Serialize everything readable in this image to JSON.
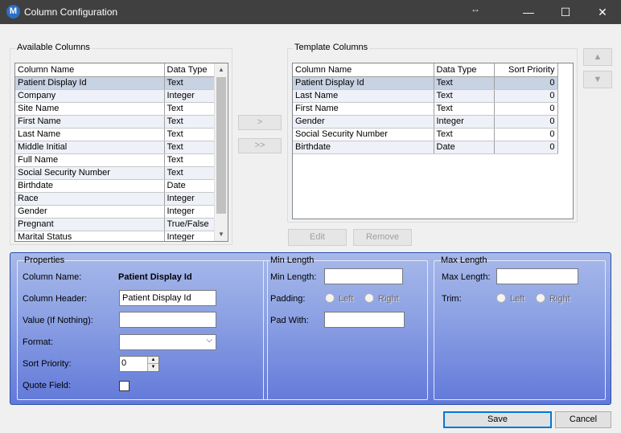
{
  "window": {
    "title": "Column Configuration",
    "app_icon_letter": "M",
    "resize_glyph": "↔",
    "minimize": "—",
    "maximize": "☐",
    "close": "✕"
  },
  "available": {
    "group_label": "Available Columns",
    "headers": [
      "Column Name",
      "Data Type"
    ],
    "rows": [
      [
        "Patient Display Id",
        "Text"
      ],
      [
        "Company",
        "Integer"
      ],
      [
        "Site Name",
        "Text"
      ],
      [
        "First Name",
        "Text"
      ],
      [
        "Last Name",
        "Text"
      ],
      [
        "Middle Initial",
        "Text"
      ],
      [
        "Full Name",
        "Text"
      ],
      [
        "Social Security Number",
        "Text"
      ],
      [
        "Birthdate",
        "Date"
      ],
      [
        "Race",
        "Integer"
      ],
      [
        "Gender",
        "Integer"
      ],
      [
        "Pregnant",
        "True/False"
      ],
      [
        "Marital Status",
        "Integer"
      ]
    ]
  },
  "move": {
    "add_one": ">",
    "add_all": ">>"
  },
  "template": {
    "group_label": "Template Columns",
    "headers": [
      "Column Name",
      "Data Type",
      "Sort Priority"
    ],
    "rows": [
      [
        "Patient Display Id",
        "Text",
        "0"
      ],
      [
        "Last Name",
        "Text",
        "0"
      ],
      [
        "First Name",
        "Text",
        "0"
      ],
      [
        "Gender",
        "Integer",
        "0"
      ],
      [
        "Social Security Number",
        "Text",
        "0"
      ],
      [
        "Birthdate",
        "Date",
        "0"
      ]
    ],
    "edit_label": "Edit",
    "remove_label": "Remove",
    "up_label": "▲",
    "down_label": "▼"
  },
  "properties": {
    "group_label": "Properties",
    "column_name_label": "Column Name:",
    "column_name_value": "Patient Display Id",
    "column_header_label": "Column Header:",
    "column_header_value": "Patient Display Id",
    "value_if_nothing_label": "Value (If Nothing):",
    "value_if_nothing_value": "",
    "format_label": "Format:",
    "format_value": "",
    "sort_priority_label": "Sort Priority:",
    "sort_priority_value": "0",
    "quote_field_label": "Quote Field:"
  },
  "min_length": {
    "group_label": "Min Length",
    "min_length_label": "Min Length:",
    "min_length_value": "",
    "padding_label": "Padding:",
    "left_label": "Left",
    "right_label": "Right",
    "pad_with_label": "Pad With:",
    "pad_with_value": ""
  },
  "max_length": {
    "group_label": "Max Length",
    "max_length_label": "Max Length:",
    "max_length_value": "",
    "trim_label": "Trim:",
    "left_label": "Left",
    "right_label": "Right"
  },
  "footer": {
    "save_label": "Save",
    "cancel_label": "Cancel"
  }
}
